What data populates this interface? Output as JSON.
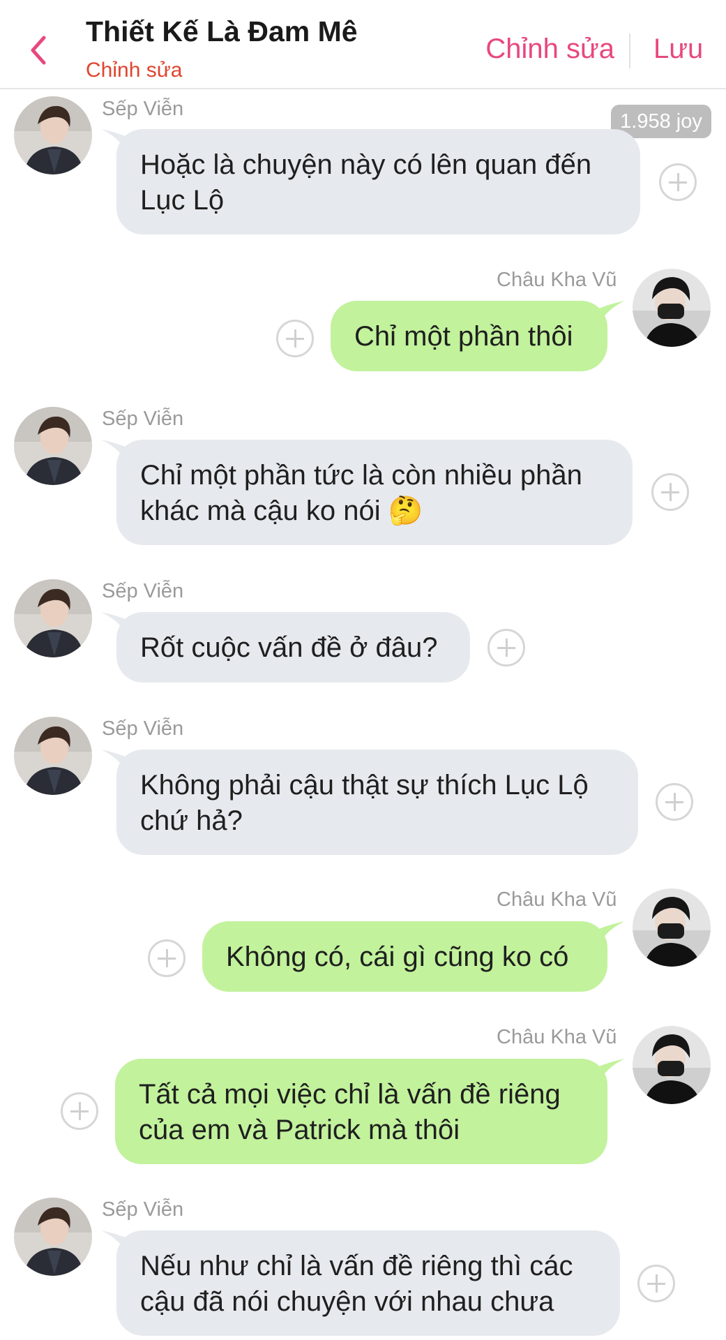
{
  "header": {
    "title": "Thiết Kế Là Đam Mê",
    "subtitle": "Chỉnh sửa",
    "edit_label": "Chỉnh sửa",
    "save_label": "Lưu",
    "accent_color": "#e8477f"
  },
  "joy_badge": "1.958 joy",
  "messages": [
    {
      "sender": "Sếp Viễn",
      "direction": "in",
      "lines": [
        "Hoặc là chuyện này có lên quan đến",
        "Lục Lộ"
      ]
    },
    {
      "sender": "Châu Kha Vũ",
      "direction": "out",
      "lines": [
        "Chỉ một phần thôi"
      ]
    },
    {
      "sender": "Sếp Viễn",
      "direction": "in",
      "lines": [
        "Chỉ một phần tức là còn nhiều phần",
        "khác mà cậu ko nói 🤔"
      ]
    },
    {
      "sender": "Sếp Viễn",
      "direction": "in",
      "lines": [
        "Rốt cuộc vấn đề ở đâu?"
      ]
    },
    {
      "sender": "Sếp Viễn",
      "direction": "in",
      "lines": [
        "Không phải cậu thật sự thích Lục Lộ",
        "chứ hả?"
      ]
    },
    {
      "sender": "Châu Kha Vũ",
      "direction": "out",
      "lines": [
        "Không có, cái gì cũng ko có"
      ]
    },
    {
      "sender": "Châu Kha Vũ",
      "direction": "out",
      "lines": [
        "Tất cả mọi việc chỉ là vấn đề riêng",
        "của em và Patrick mà thôi"
      ]
    },
    {
      "sender": "Sếp Viễn",
      "direction": "in",
      "lines": [
        "Nếu như chỉ là vấn đề riêng thì các",
        "cậu đã nói chuyện với nhau chưa"
      ]
    }
  ]
}
